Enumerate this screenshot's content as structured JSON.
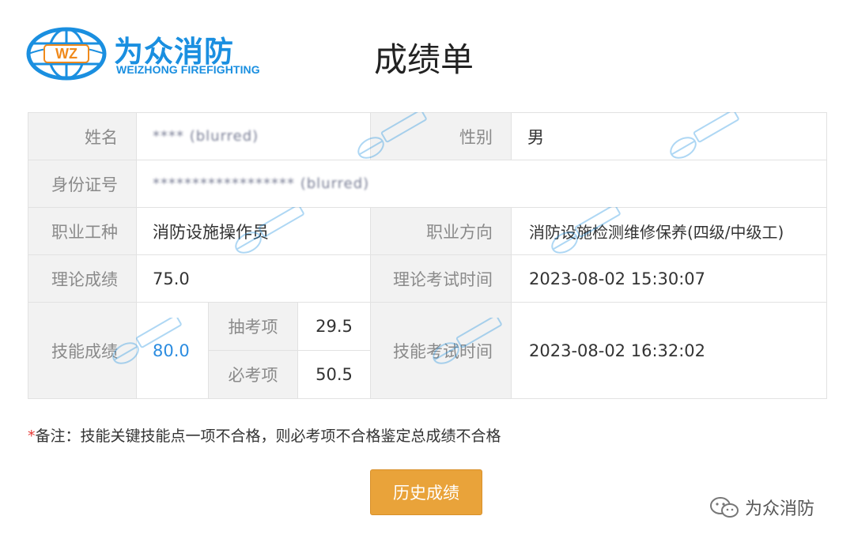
{
  "logo": {
    "badge": "WZ",
    "name_cn": "为众消防",
    "name_en": "WEIZHONG FIREFIGHTING"
  },
  "page_title": "成绩单",
  "table": {
    "name_label": "姓名",
    "name_value": "**** (blurred)",
    "gender_label": "性别",
    "gender_value": "男",
    "id_label": "身份证号",
    "id_value": "****************** (blurred)",
    "occupation_label": "职业工种",
    "occupation_value": "消防设施操作员",
    "direction_label": "职业方向",
    "direction_value": "消防设施检测维修保养(四级/中级工)",
    "theory_score_label": "理论成绩",
    "theory_score_value": "75.0",
    "theory_time_label": "理论考试时间",
    "theory_time_value": "2023-08-02 15:30:07",
    "skill_score_label": "技能成绩",
    "skill_score_value": "80.0",
    "sample_item_label": "抽考项",
    "sample_item_value": "29.5",
    "required_item_label": "必考项",
    "required_item_value": "50.5",
    "skill_time_label": "技能考试时间",
    "skill_time_value": "2023-08-02 16:32:02"
  },
  "note": {
    "star": "*",
    "text": "备注：技能关键技能点一项不合格，则必考项不合格鉴定总成绩不合格"
  },
  "history_button": "历史成绩",
  "wechat": {
    "icon": "wechat-icon",
    "account_name": "为众消防"
  },
  "colors": {
    "brand_blue": "#1a8fe0",
    "button_orange": "#e9a33a",
    "label_bg": "#f2f2f2",
    "label_text": "#8a8a8a",
    "skill_score_blue": "#2b8ce0",
    "required_star": "#e53935"
  }
}
